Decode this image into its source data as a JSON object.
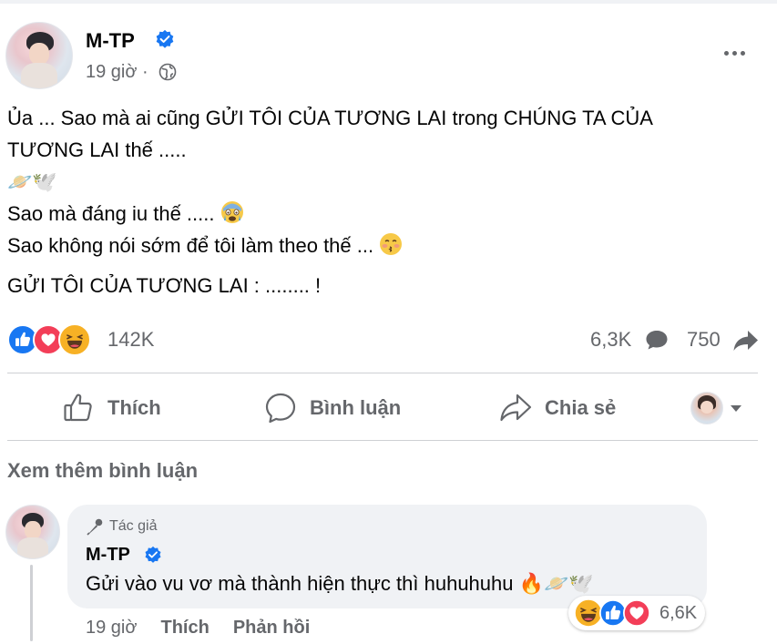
{
  "post": {
    "author": "M-TP",
    "time": "19 giờ ·",
    "lines": [
      "Ủa ... Sao mà ai cũng GỬI TÔI CỦA TƯƠNG LAI trong CHÚNG TA CỦA",
      "TƯƠNG LAI thế .....",
      "🪐🕊️",
      "Sao mà đáng iu thế .....",
      "Sao không nói sớm để tôi làm theo thế ...",
      "GỬI TÔI CỦA TƯƠNG LAI : ........ !"
    ],
    "icons": {
      "verified": "verified-badge-icon",
      "privacy": "globe-icon",
      "more": "more-options-icon"
    }
  },
  "stats": {
    "reactions": "142K",
    "comments": "6,3K",
    "shares": "750"
  },
  "actions": {
    "like": "Thích",
    "comment": "Bình luận",
    "share": "Chia sẻ"
  },
  "comments_section": {
    "view_more": "Xem thêm bình luận",
    "comment": {
      "badge": "Tác giả",
      "author": "M-TP",
      "text": "Gửi vào vu vơ mà thành hiện thực thì huhuhuhu 🔥🪐🕊️",
      "time": "19 giờ",
      "like": "Thích",
      "reply": "Phản hồi",
      "reactions": "6,6K"
    }
  },
  "colors": {
    "text": "#050505",
    "secondary": "#65676b",
    "like_blue": "#1877f2",
    "love_red": "#f33e58",
    "haha_yellow": "#f7b125",
    "bubble": "#f0f2f5"
  }
}
